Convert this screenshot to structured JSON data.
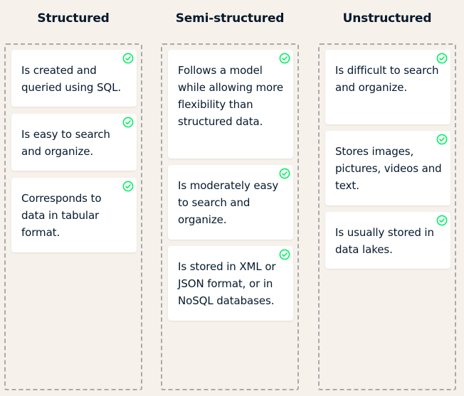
{
  "columns": [
    {
      "title": "Structured",
      "cards": [
        {
          "text": "Is created and queried using SQL."
        },
        {
          "text": "Is easy to search and organize."
        },
        {
          "text": "Corresponds to data in tabular format."
        }
      ]
    },
    {
      "title": "Semi-structured",
      "cards": [
        {
          "text": "Follows a model while allowing more flexibility than structured data."
        },
        {
          "text": "Is moderately easy to search and organize."
        },
        {
          "text": "Is stored in XML or JSON format, or in NoSQL databases."
        }
      ]
    },
    {
      "title": "Unstructured",
      "cards": [
        {
          "text": "Is difficult to search and organize."
        },
        {
          "text": "Stores images, pictures, videos and text."
        },
        {
          "text": "Is usually stored in data lakes."
        }
      ]
    }
  ],
  "icons": {
    "card_status": "check-circle-icon"
  },
  "colors": {
    "background": "#f6f1ea",
    "card": "#ffffff",
    "text": "#05192d",
    "dashed_border": "#a9aaac",
    "check": "#03ef62"
  }
}
